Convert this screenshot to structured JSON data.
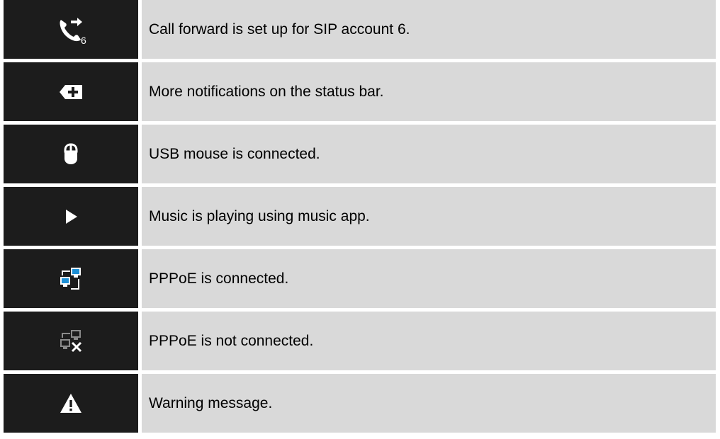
{
  "rows": [
    {
      "icon": "call-forward-sip6-icon",
      "icon_subscript": "6",
      "description": "Call forward is set up for SIP account 6."
    },
    {
      "icon": "more-notifications-icon",
      "description": "More notifications on the status bar."
    },
    {
      "icon": "usb-mouse-icon",
      "description": "USB mouse is connected."
    },
    {
      "icon": "music-play-icon",
      "description": "Music is playing using music app."
    },
    {
      "icon": "pppoe-connected-icon",
      "description": "PPPoE is connected."
    },
    {
      "icon": "pppoe-disconnected-icon",
      "description": "PPPoE is not connected."
    },
    {
      "icon": "warning-icon",
      "description": "Warning message."
    }
  ],
  "colors": {
    "icon_cell_bg": "#1c1c1c",
    "desc_cell_bg": "#d9d9d9",
    "icon_white": "#ffffff",
    "network_blue": "#1e90d6",
    "disabled_gray": "#8a8a8a"
  }
}
